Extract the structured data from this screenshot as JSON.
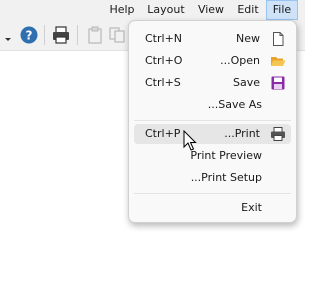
{
  "menubar": {
    "items": [
      "Help",
      "Layout",
      "View",
      "Edit",
      "File"
    ],
    "active": "File"
  },
  "toolbar": {
    "icons": [
      "dropdown-arrow-icon",
      "help-icon",
      "print-icon",
      "paste-icon",
      "copy-icon"
    ]
  },
  "file_menu": {
    "items": [
      {
        "shortcut": "Ctrl+N",
        "label": "New",
        "icon": "new-document-icon"
      },
      {
        "shortcut": "Ctrl+O",
        "label": "...Open",
        "icon": "open-folder-icon"
      },
      {
        "shortcut": "Ctrl+S",
        "label": "Save",
        "icon": "save-disk-icon"
      },
      {
        "shortcut": "",
        "label": "...Save As",
        "icon": ""
      },
      {
        "shortcut": "Ctrl+P",
        "label": "...Print",
        "icon": "printer-icon",
        "highlighted": true
      },
      {
        "shortcut": "",
        "label": "Print Preview",
        "icon": ""
      },
      {
        "shortcut": "",
        "label": "...Print Setup",
        "icon": ""
      },
      {
        "shortcut": "",
        "label": "Exit",
        "icon": ""
      }
    ]
  },
  "colors": {
    "menubar_bg": "#f1f1f1",
    "menu_bg": "#f9f9f9",
    "hover_bg": "#e6e6e6",
    "folder": "#f0b43a",
    "save": "#8a2aa6",
    "help": "#2f6fb0"
  }
}
